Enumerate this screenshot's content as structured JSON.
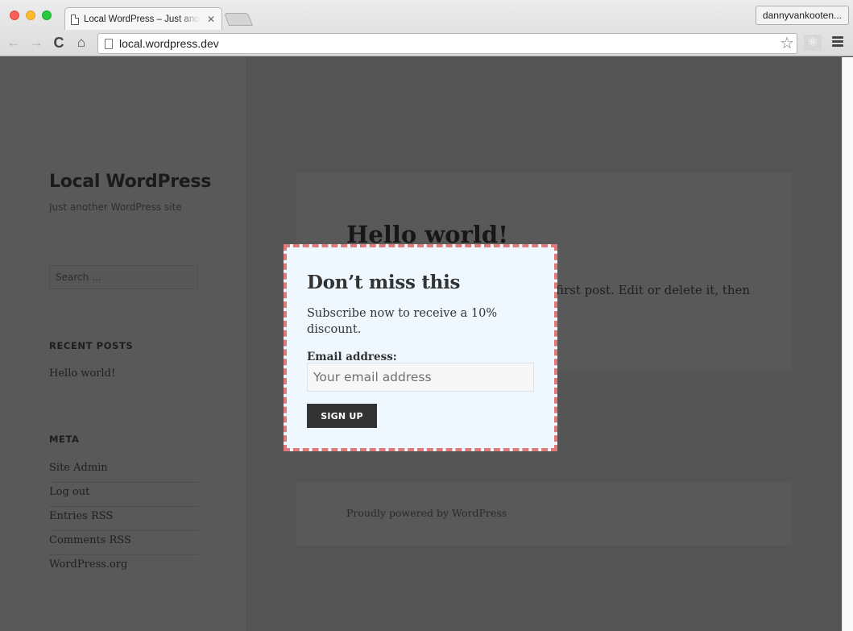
{
  "browser": {
    "tab_title": "Local WordPress – Just another WordPress site",
    "tab_close": "✕",
    "profile_name": "dannyvankooten...",
    "url": "local.wordpress.dev",
    "icons": {
      "back": "←",
      "forward": "→",
      "reload": "C",
      "home": "⌂",
      "star": "☆",
      "extension": "⚛"
    }
  },
  "site": {
    "title": "Local WordPress",
    "description": "Just another WordPress site",
    "search_placeholder": "Search …"
  },
  "widgets": {
    "recent_posts": {
      "title": "RECENT POSTS",
      "items": [
        "Hello world!"
      ]
    },
    "meta": {
      "title": "META",
      "items": [
        "Site Admin",
        "Log out",
        "Entries RSS",
        "Comments RSS",
        "WordPress.org"
      ]
    }
  },
  "post": {
    "title": "Hello world!",
    "excerpt_visible": "first post. Edit or delete it, then"
  },
  "footer": {
    "text": "Proudly powered by WordPress"
  },
  "popup": {
    "title": "Don’t miss this",
    "text": "Subscribe now to receive a 10% discount.",
    "email_label": "Email address:",
    "email_placeholder": "Your email address",
    "email_value": "",
    "button_label": "SIGN UP",
    "border_color": "#e07a7a",
    "background_color": "#eef8fe"
  }
}
